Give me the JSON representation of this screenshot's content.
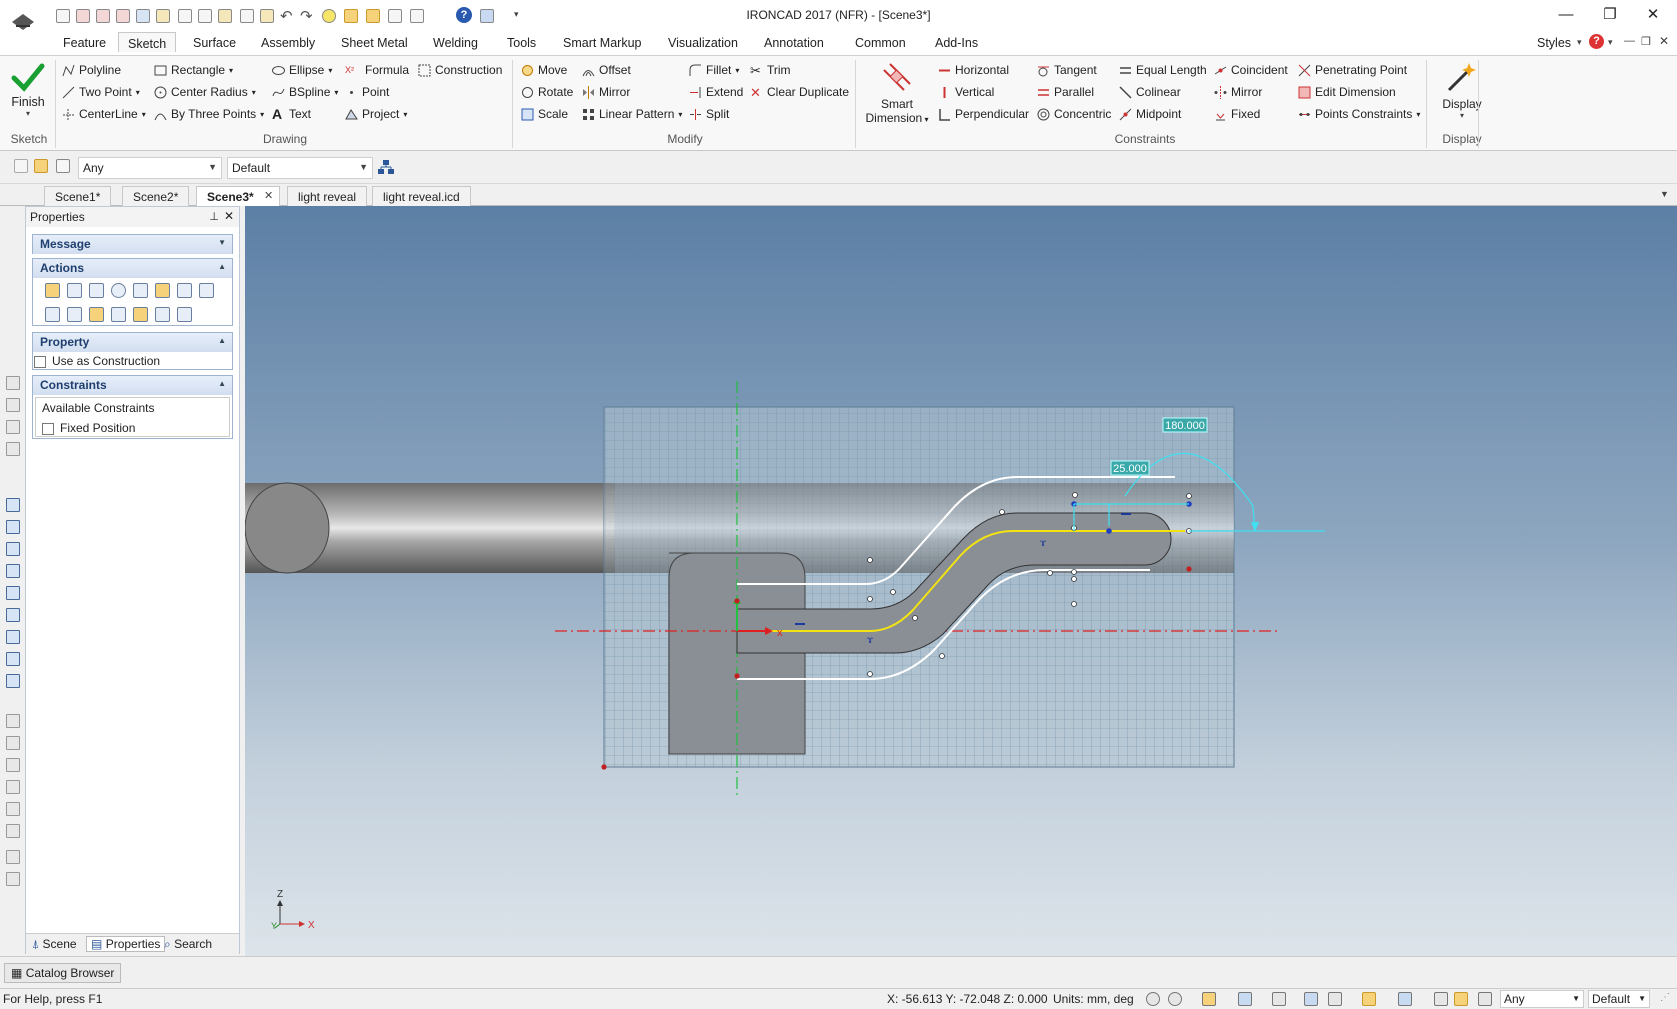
{
  "window": {
    "title": "IRONCAD 2017 (NFR) - [Scene3*]",
    "controls": {
      "minimize": "—",
      "restore": "❐",
      "close": "✕"
    }
  },
  "menu": {
    "tabs": [
      "Feature",
      "Sketch",
      "Surface",
      "Assembly",
      "Sheet Metal",
      "Welding",
      "Tools",
      "Smart Markup",
      "Visualization",
      "Annotation",
      "Common",
      "Add-Ins"
    ],
    "active": "Sketch",
    "styles_label": "Styles"
  },
  "ribbon": {
    "sketch_group": {
      "finish": "Finish",
      "label": "Sketch"
    },
    "drawing_group": {
      "label": "Drawing",
      "items": [
        "Polyline",
        "Two Point",
        "CenterLine",
        "Rectangle",
        "Center Radius",
        "By Three Points",
        "Ellipse",
        "BSpline",
        "Text",
        "Formula",
        "Point",
        "Project",
        "Construction"
      ]
    },
    "modify_group": {
      "label": "Modify",
      "items": [
        "Move",
        "Rotate",
        "Scale",
        "Offset",
        "Mirror",
        "Linear Pattern",
        "Fillet",
        "Extend",
        "Split",
        "Trim",
        "Clear Duplicate"
      ]
    },
    "smart_dimension": {
      "line1": "Smart",
      "line2": "Dimension"
    },
    "constraints_group": {
      "label": "Constraints",
      "items": [
        "Horizontal",
        "Vertical",
        "Perpendicular",
        "Tangent",
        "Parallel",
        "Concentric",
        "Equal Length",
        "Colinear",
        "Midpoint",
        "Coincident",
        "Mirror",
        "Fixed",
        "Penetrating Point",
        "Edit Dimension",
        "Points Constraints"
      ]
    },
    "display_group": {
      "button": "Display",
      "label": "Display"
    }
  },
  "toolbar2": {
    "filter_value": "Any",
    "style_value": "Default"
  },
  "doc_tabs": [
    "Scene1*",
    "Scene2*",
    "Scene3*",
    "light reveal",
    "light reveal.icd"
  ],
  "active_doc_tab": "Scene3*",
  "properties_panel": {
    "title": "Properties",
    "sections": {
      "message": "Message",
      "actions": "Actions",
      "property": "Property",
      "use_as_construction": "Use as Construction",
      "constraints": "Constraints",
      "available_constraints": "Available Constraints",
      "fixed_position": "Fixed Position"
    },
    "bottom_tabs": [
      "Scene",
      "Properties",
      "Search"
    ]
  },
  "viewport": {
    "dimension_angle": "180.000",
    "dimension_length": "25.000",
    "triad": {
      "z": "Z",
      "y": "Y",
      "x": "X"
    }
  },
  "catalog_browser": "Catalog Browser",
  "status": {
    "help": "For Help, press F1",
    "coords": "X: -56.613 Y: -72.048 Z: 0.000",
    "units": "Units: mm, deg",
    "filter_value": "Any",
    "style_value": "Default"
  },
  "colors": {
    "accent_blue": "#2b579a",
    "sketch_yellow": "#f3e312",
    "axis_red": "#e02020",
    "axis_green": "#20c040",
    "dim_cyan": "#40e0f0"
  }
}
